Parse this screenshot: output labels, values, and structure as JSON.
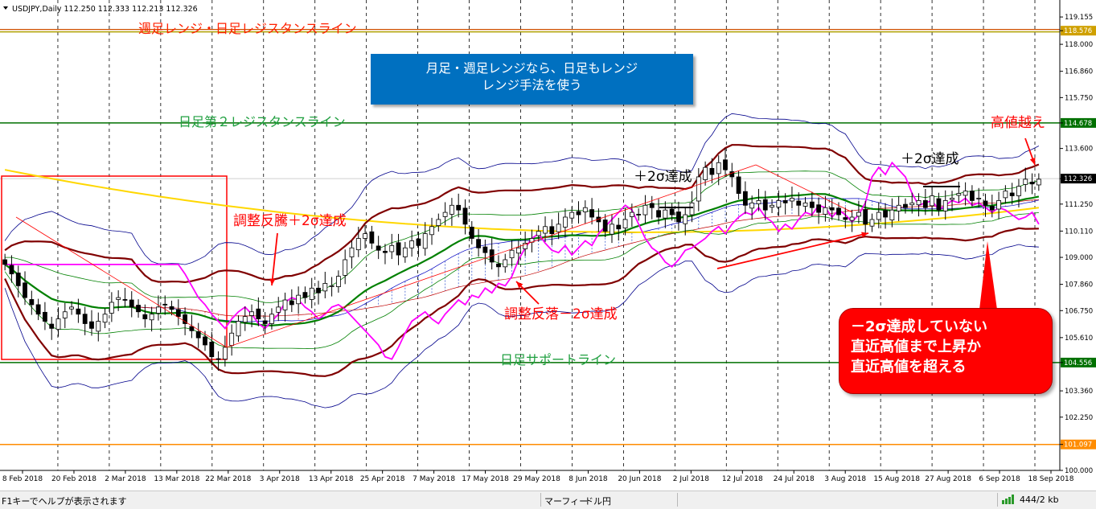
{
  "chart_data": {
    "type": "candlestick",
    "symbol_header": "USDJPY,Daily  112.250 112.333 112.213 112.326",
    "ylim": [
      100.0,
      119.6
    ],
    "y_ticks": [
      "119.155",
      "118.576",
      "118.000",
      "116.860",
      "115.750",
      "114.678",
      "113.600",
      "112.326",
      "111.250",
      "110.110",
      "109.000",
      "107.860",
      "106.750",
      "105.610",
      "104.556",
      "103.360",
      "102.250",
      "101.097",
      "100.000"
    ],
    "x_ticks": [
      "8 Feb 2018",
      "20 Feb 2018",
      "2 Mar 2018",
      "13 Mar 2018",
      "22 Mar 2018",
      "3 Apr 2018",
      "13 Apr 2018",
      "25 Apr 2018",
      "7 May 2018",
      "17 May 2018",
      "29 May 2018",
      "8 Jun 2018",
      "20 Jun 2018",
      "2 Jul 2018",
      "12 Jul 2018",
      "24 Jul 2018",
      "3 Aug 2018",
      "15 Aug 2018",
      "27 Aug 2018",
      "6 Sep 2018",
      "18 Sep 2018"
    ],
    "close_series": [
      108.7,
      108.3,
      107.8,
      107.3,
      107.0,
      106.6,
      106.3,
      106.0,
      106.4,
      106.7,
      106.9,
      106.6,
      106.2,
      106.0,
      106.3,
      106.6,
      107.1,
      107.3,
      107.2,
      106.9,
      106.7,
      106.4,
      106.6,
      106.9,
      107.0,
      106.8,
      106.5,
      106.2,
      105.9,
      105.6,
      105.3,
      104.8,
      104.7,
      105.2,
      105.8,
      106.3,
      106.5,
      106.7,
      106.4,
      106.2,
      106.6,
      106.9,
      107.2,
      107.0,
      107.4,
      107.3,
      107.7,
      107.5,
      107.9,
      107.8,
      108.2,
      108.9,
      109.4,
      109.8,
      110.0,
      109.6,
      109.3,
      109.2,
      109.5,
      109.1,
      109.4,
      109.7,
      109.5,
      110.0,
      110.3,
      110.6,
      110.9,
      111.2,
      111.0,
      110.4,
      109.8,
      109.4,
      109.2,
      108.8,
      108.6,
      108.9,
      109.3,
      109.4,
      109.6,
      109.8,
      110.1,
      110.3,
      110.0,
      110.4,
      110.7,
      110.9,
      110.8,
      111.1,
      110.7,
      110.5,
      110.1,
      110.4,
      110.2,
      110.6,
      110.9,
      110.8,
      111.2,
      111.1,
      110.7,
      111.0,
      110.8,
      110.5,
      110.8,
      111.3,
      112.4,
      112.8,
      112.5,
      113.0,
      112.7,
      112.4,
      111.7,
      111.2,
      111.3,
      111.4,
      111.0,
      111.2,
      111.4,
      111.3,
      111.5,
      111.2,
      111.3,
      111.1,
      110.9,
      111.1,
      111.0,
      110.8,
      110.6,
      110.7,
      110.9,
      110.4,
      110.6,
      110.9,
      110.7,
      111.0,
      111.2,
      111.1,
      111.3,
      111.4,
      111.1,
      111.6,
      111.0,
      111.4,
      111.5,
      111.7,
      111.8,
      111.4,
      111.5,
      111.2,
      111.0,
      111.4,
      111.8,
      111.6,
      112.0,
      112.3,
      112.1,
      112.3
    ],
    "horizontal_lines": [
      {
        "name": "週足レンジ・日足レジスタンスライン",
        "price": 118.576,
        "color": "#cfa000",
        "price_label": "118.576"
      },
      {
        "name": "日足第２レジスタンスライン",
        "price": 114.678,
        "color": "#007000",
        "price_label": "114.678"
      },
      {
        "name": "日足サポートライン",
        "price": 104.556,
        "color": "#007000",
        "price_label": "104.556"
      },
      {
        "name": "",
        "price": 101.097,
        "color": "#ff8c00",
        "price_label": "101.097"
      }
    ],
    "current_price_label": "112.326",
    "annotations": {
      "weekly_range_label": "週足レンジ・日足レジスタンスライン",
      "second_resistance_label": "日足第２レジスタンスライン",
      "support_label": "日足サポートライン",
      "rebound_label": "調整反騰＋2σ達成",
      "pullback_label": "調整反落－2σ達成",
      "plus2sigma_1": "＋2σ達成",
      "plus2sigma_2": "＋2σ達成",
      "high_break": "高値越え"
    },
    "colors": {
      "bullish": "#ffffff",
      "bearish": "#000000",
      "sma": "#007000",
      "long_ma": "#ffd700",
      "bands_outer": "#800000",
      "bands_inner": "#00008b",
      "magenta_line": "#ff00ff",
      "annotation_red": "#ff0000"
    }
  },
  "callouts": {
    "blue_box_line1": "月足・週足レンジなら、日足もレンジ",
    "blue_box_line2": "レンジ手法を使う",
    "red_box_line1": "－2σ達成していない",
    "red_box_line2": "直近高値まで上昇か",
    "red_box_line3": "直近高値を超える"
  },
  "statusbar": {
    "help_text": "F1キーでヘルプが表示されます",
    "profile": "マーフィー",
    "symbol": "ドル円",
    "traffic": "444/2 kb"
  }
}
